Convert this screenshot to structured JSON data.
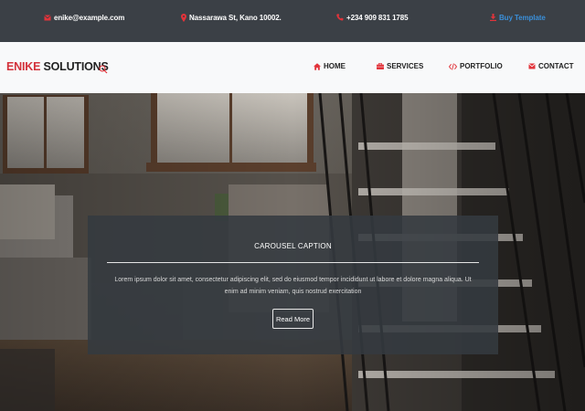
{
  "topbar": {
    "email": "enike@example.com",
    "address": "Nassarawa St, Kano 10002.",
    "phone": "+234 909 831 1785",
    "buy": "Buy Template"
  },
  "nav": {
    "brand_accent": "ENIKE",
    "brand_rest": "SOLUTIONS",
    "items": [
      {
        "label": "HOME",
        "icon": "home-icon"
      },
      {
        "label": "SERVICES",
        "icon": "briefcase-icon"
      },
      {
        "label": "PORTFOLIO",
        "icon": "code-icon"
      },
      {
        "label": "CONTACT",
        "icon": "envelope-icon"
      }
    ]
  },
  "carousel": {
    "title": "CAROUSEL CAPTION",
    "text": "Lorem ipsum dolor sit amet, consectetur adipiscing elit, sed do eiusmod tempor incididunt ut labore et dolore magna aliqua. Ut enim ad minim veniam, quis nostrud exercitation",
    "button": "Read More"
  },
  "colors": {
    "accent": "#d3313a",
    "link": "#3a8fd9",
    "topbar_bg": "#3b4046",
    "nav_bg": "#f8f9fa"
  }
}
